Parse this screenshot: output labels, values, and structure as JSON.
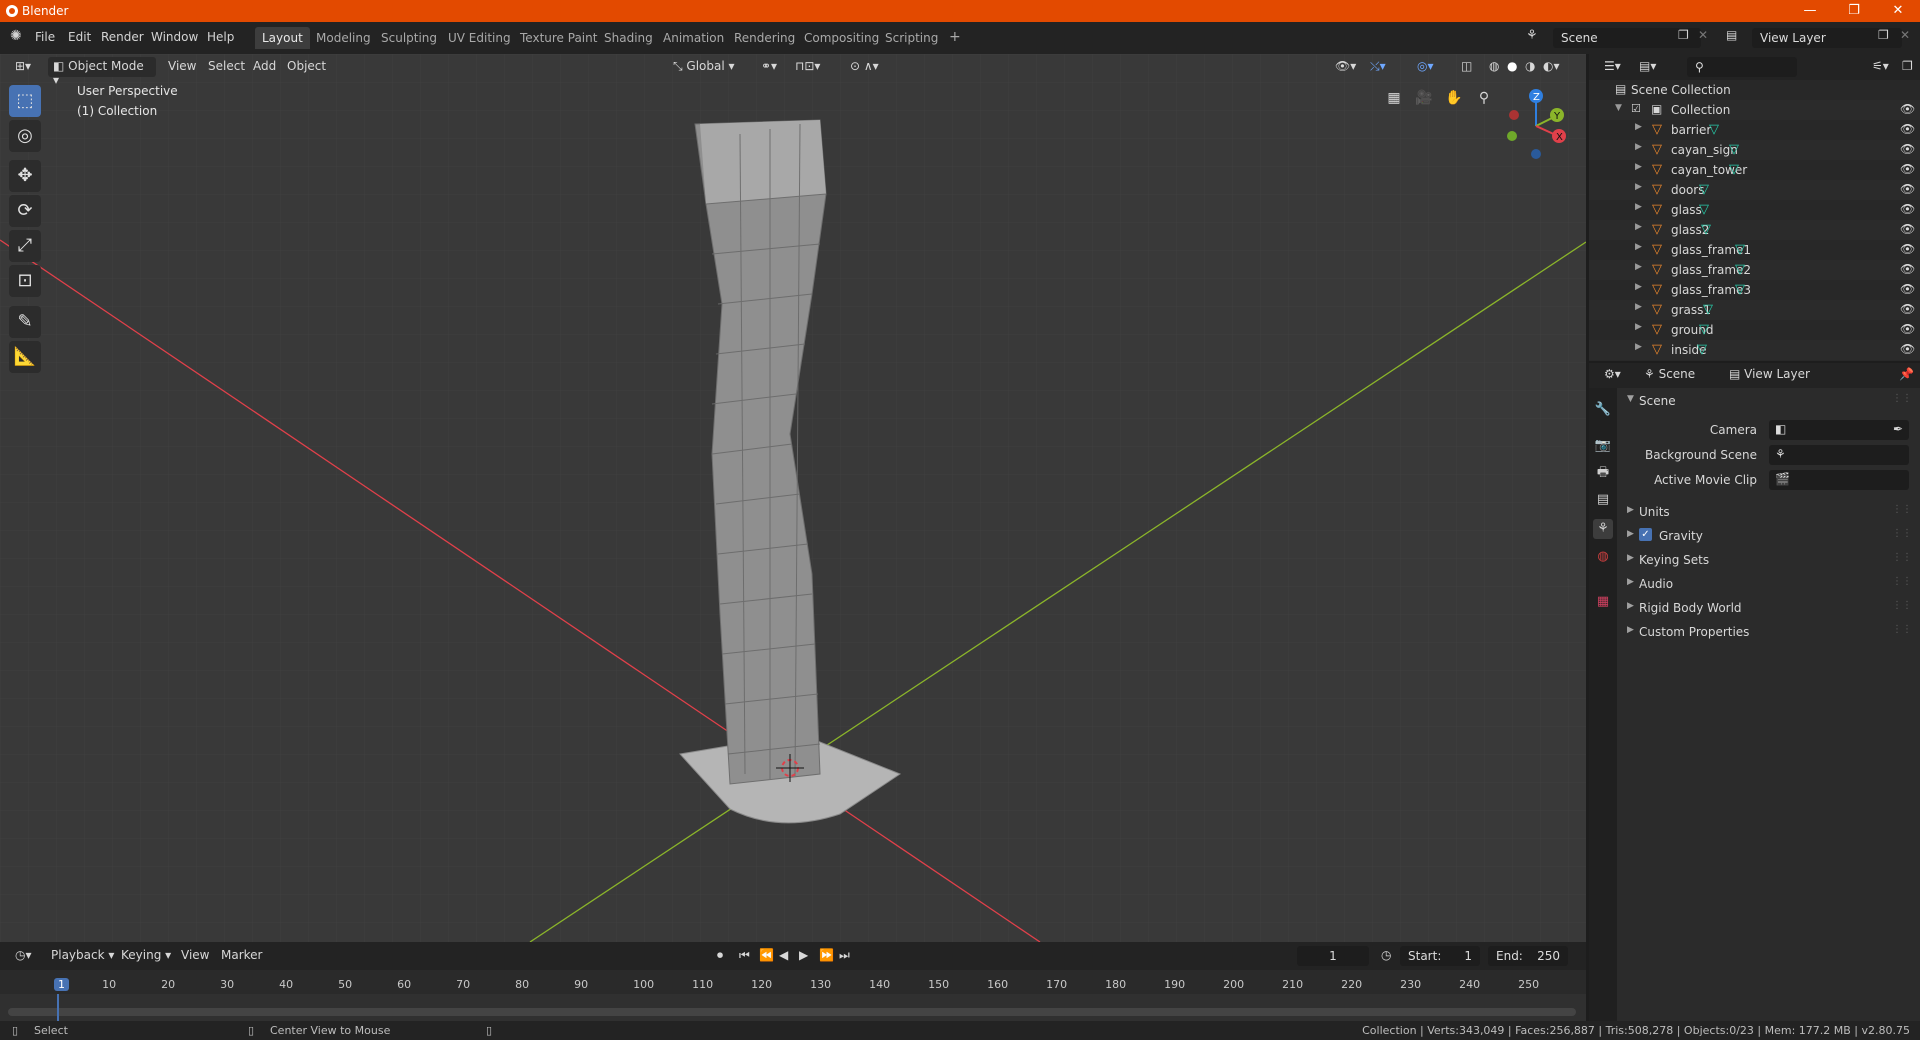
{
  "window": {
    "title": "Blender",
    "controls": [
      "—",
      "❐",
      "✕"
    ]
  },
  "menu": {
    "items": [
      "File",
      "Edit",
      "Render",
      "Window",
      "Help"
    ]
  },
  "workspaces": [
    "Layout",
    "Modeling",
    "Sculpting",
    "UV Editing",
    "Texture Paint",
    "Shading",
    "Animation",
    "Rendering",
    "Compositing",
    "Scripting"
  ],
  "workspace_add": "+",
  "topright": {
    "scene": "Scene",
    "view_layer": "View Layer"
  },
  "viewport_header": {
    "mode": "Object Mode",
    "view": "View",
    "select": "Select",
    "add": "Add",
    "object": "Object",
    "transform": "Global"
  },
  "viewport": {
    "perspective": "User Perspective",
    "collection": "(1) Collection",
    "gizmo": {
      "z": "Z",
      "y": "Y",
      "x": "X"
    }
  },
  "outliner": {
    "root": "Scene Collection",
    "collection": "Collection",
    "objects": [
      "barrier",
      "cayan_sign",
      "cayan_tower",
      "doors",
      "glass",
      "glass2",
      "glass_frame1",
      "glass_frame2",
      "glass_frame3",
      "grass1",
      "ground",
      "inside"
    ]
  },
  "properties": {
    "breadcrumb_scene": "Scene",
    "breadcrumb_layer": "View Layer",
    "panel_scene": "Scene",
    "camera_label": "Camera",
    "background_scene_label": "Background Scene",
    "active_movie_clip_label": "Active Movie Clip",
    "panels": [
      "Units",
      "Gravity",
      "Keying Sets",
      "Audio",
      "Rigid Body World",
      "Custom Properties"
    ]
  },
  "timeline": {
    "playback": "Playback",
    "keying": "Keying",
    "view": "View",
    "marker": "Marker",
    "current_frame": "1",
    "start_label": "Start:",
    "start": "1",
    "end_label": "End:",
    "end": "250",
    "ticks": [
      "1",
      "10",
      "20",
      "30",
      "40",
      "50",
      "60",
      "70",
      "80",
      "90",
      "100",
      "110",
      "120",
      "130",
      "140",
      "150",
      "160",
      "170",
      "180",
      "190",
      "200",
      "210",
      "220",
      "230",
      "240",
      "250"
    ]
  },
  "statusbar": {
    "select": "Select",
    "center_view": "Center View to Mouse",
    "stats": "Collection | Verts:343,049 | Faces:256,887 | Tris:508,278 | Objects:0/23 | Mem: 177.2 MB | v2.80.75"
  },
  "colors": {
    "titlebar": "#e34a00",
    "active_tool": "#4772b3",
    "axis_x": "#e0404a",
    "axis_y": "#8bb52a",
    "axis_z": "#2f7fe0"
  }
}
